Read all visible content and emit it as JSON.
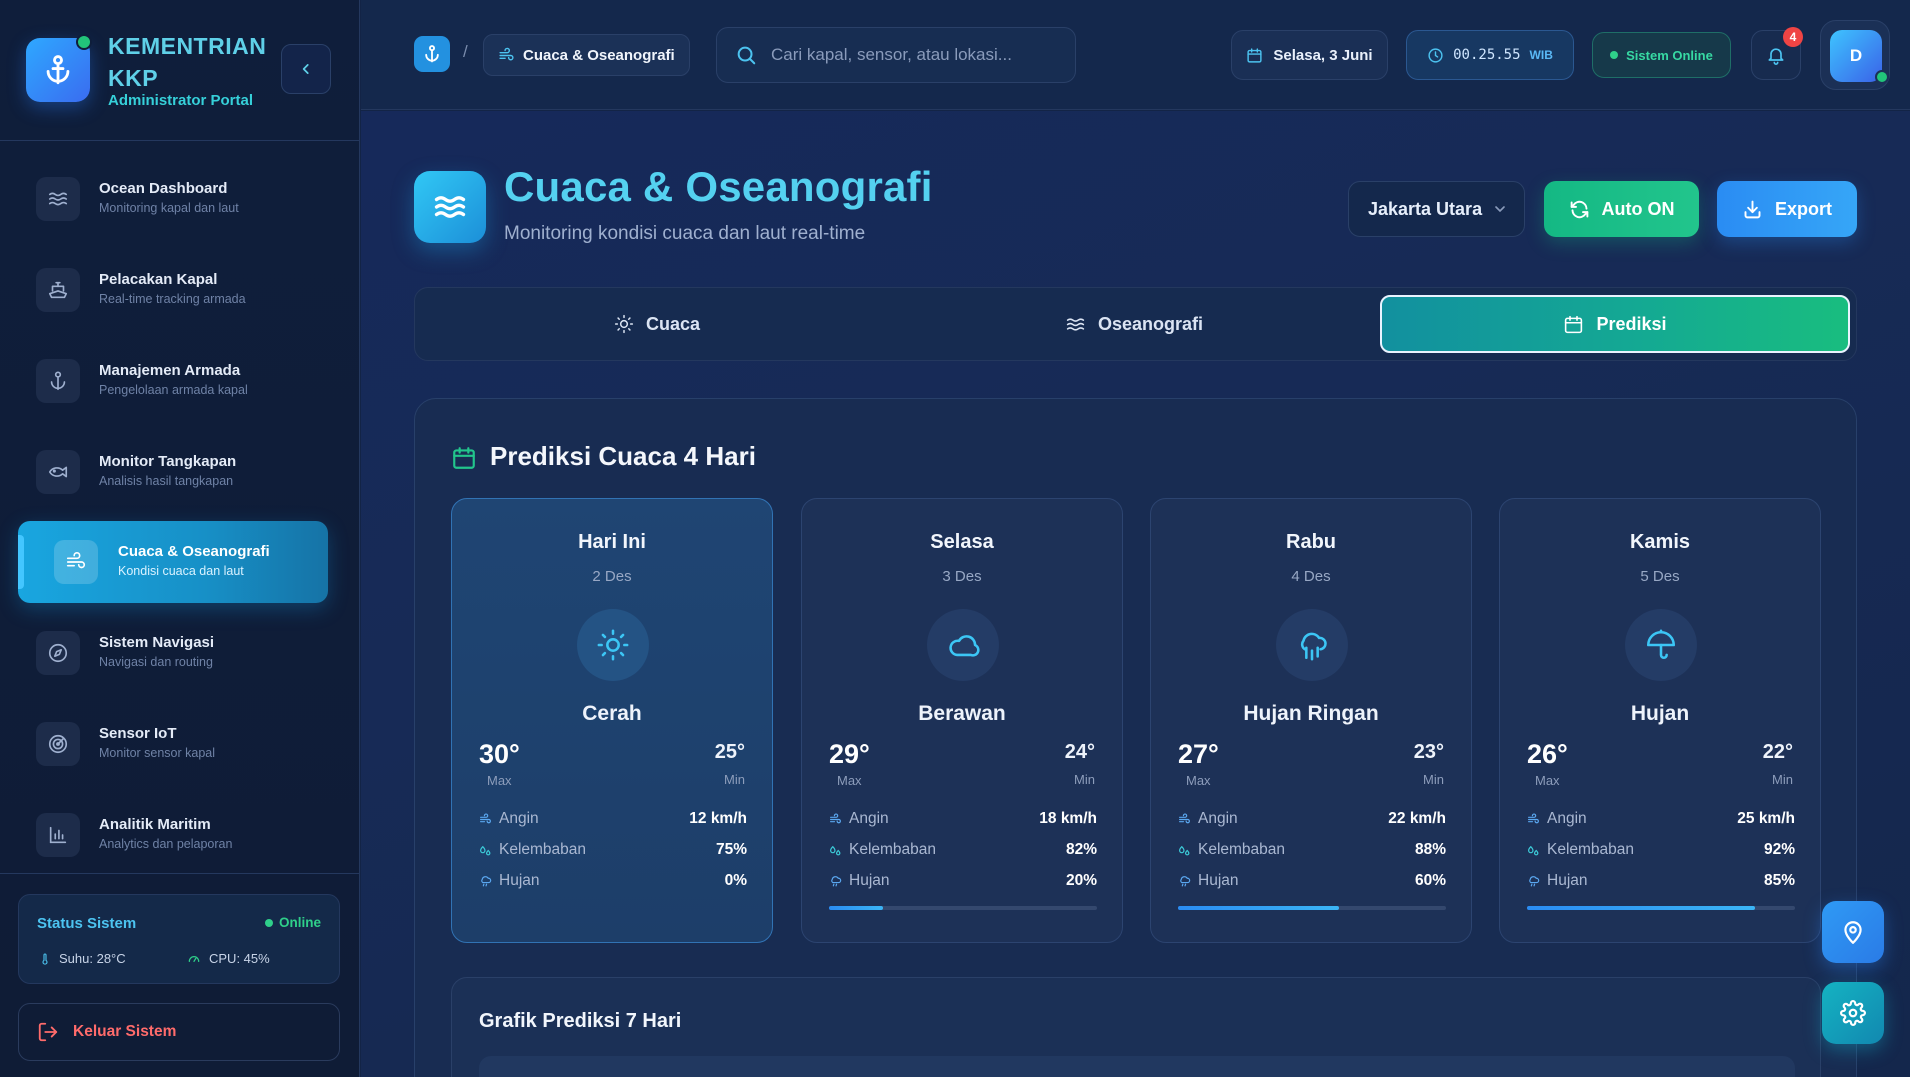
{
  "brand": {
    "title": "KEMENTRIAN KKP",
    "subtitle": "Administrator Portal"
  },
  "sidebar": {
    "items": [
      {
        "label": "Ocean Dashboard",
        "sub": "Monitoring kapal dan laut",
        "icon": "waves-icon"
      },
      {
        "label": "Pelacakan Kapal",
        "sub": "Real-time tracking armada",
        "icon": "ship-icon"
      },
      {
        "label": "Manajemen Armada",
        "sub": "Pengelolaan armada kapal",
        "icon": "anchor-icon"
      },
      {
        "label": "Monitor Tangkapan",
        "sub": "Analisis hasil tangkapan",
        "icon": "fish-icon"
      },
      {
        "label": "Cuaca & Oseanografi",
        "sub": "Kondisi cuaca dan laut",
        "icon": "wind-icon",
        "active": true
      },
      {
        "label": "Sistem Navigasi",
        "sub": "Navigasi dan routing",
        "icon": "compass-icon"
      },
      {
        "label": "Sensor IoT",
        "sub": "Monitor sensor kapal",
        "icon": "radar-icon"
      },
      {
        "label": "Analitik Maritim",
        "sub": "Analytics dan pelaporan",
        "icon": "bar-chart-icon"
      }
    ],
    "status": {
      "title": "Status Sistem",
      "state": "Online",
      "temp": "Suhu: 28°C",
      "cpu": "CPU: 45%"
    },
    "logout": "Keluar Sistem"
  },
  "topbar": {
    "breadcrumb_sep": "/",
    "breadcrumb_current": "Cuaca & Oseanografi",
    "search_placeholder": "Cari kapal, sensor, atau lokasi...",
    "date": "Selasa, 3 Juni",
    "time": "00.25.55",
    "timezone": "WIB",
    "system_status": "Sistem Online",
    "notifications": "4",
    "avatar_initial": "D"
  },
  "page": {
    "title": "Cuaca & Oseanografi",
    "subtitle": "Monitoring kondisi cuaca dan laut real-time",
    "location": "Jakarta Utara",
    "auto_label": "Auto ON",
    "export_label": "Export"
  },
  "tabs": [
    {
      "label": "Cuaca",
      "icon": "sun-icon"
    },
    {
      "label": "Oseanografi",
      "icon": "waves-icon"
    },
    {
      "label": "Prediksi",
      "icon": "calendar-icon",
      "active": true
    }
  ],
  "forecast": {
    "title": "Prediksi Cuaca 4 Hari",
    "labels": {
      "max": "Max",
      "min": "Min",
      "wind": "Angin",
      "humidity": "Kelembaban",
      "rain": "Hujan"
    },
    "days": [
      {
        "name": "Hari Ini",
        "date": "2 Des",
        "icon": "sun-icon",
        "condition": "Cerah",
        "max": "30°",
        "min": "25°",
        "wind": "12 km/h",
        "humidity": "75%",
        "rain": "0%",
        "rain_fraction": 0
      },
      {
        "name": "Selasa",
        "date": "3 Des",
        "icon": "cloud-icon",
        "condition": "Berawan",
        "max": "29°",
        "min": "24°",
        "wind": "18 km/h",
        "humidity": "82%",
        "rain": "20%",
        "rain_fraction": 0.2
      },
      {
        "name": "Rabu",
        "date": "4 Des",
        "icon": "cloud-rain-icon",
        "condition": "Hujan Ringan",
        "max": "27°",
        "min": "23°",
        "wind": "22 km/h",
        "humidity": "88%",
        "rain": "60%",
        "rain_fraction": 0.6
      },
      {
        "name": "Kamis",
        "date": "5 Des",
        "icon": "umbrella-icon",
        "condition": "Hujan",
        "max": "26°",
        "min": "22°",
        "wind": "25 km/h",
        "humidity": "92%",
        "rain": "85%",
        "rain_fraction": 0.85
      }
    ]
  },
  "chart_section": {
    "title": "Grafik Prediksi 7 Hari"
  },
  "colors": {
    "accent": "#54d1f0",
    "success": "#22c58c",
    "primary": "#2a8cf3",
    "danger": "#ef4444"
  }
}
